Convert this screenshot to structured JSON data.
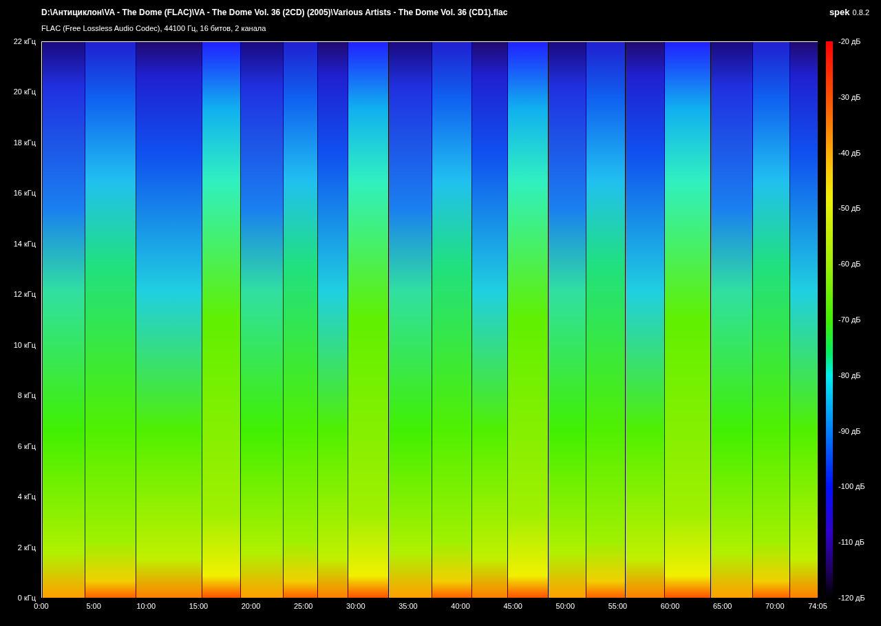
{
  "header": {
    "file_path": "D:\\Антициклон\\VA - The Dome (FLAC)\\VA - The Dome Vol. 36 (2CD) (2005)\\Various Artists - The Dome Vol. 36 (CD1).flac",
    "app_name": "spek",
    "app_version": "0.8.2",
    "stream_info": "FLAC (Free Lossless Audio Codec), 44100 Гц, 16 битов, 2 канала"
  },
  "frequency_axis": [
    "22 кГц",
    "20 кГц",
    "18 кГц",
    "16 кГц",
    "14 кГц",
    "12 кГц",
    "10 кГц",
    "8 кГц",
    "6 кГц",
    "4 кГц",
    "2 кГц",
    "0 кГц"
  ],
  "time_axis": [
    "0:00",
    "5:00",
    "10:00",
    "15:00",
    "20:00",
    "25:00",
    "30:00",
    "35:00",
    "40:00",
    "45:00",
    "50:00",
    "55:00",
    "60:00",
    "65:00",
    "70:00",
    "74:05"
  ],
  "level_scale": [
    "-20 дБ",
    "-30 дБ",
    "-40 дБ",
    "-50 дБ",
    "-60 дБ",
    "-70 дБ",
    "-80 дБ",
    "-90 дБ",
    "-100 дБ",
    "-110 дБ",
    "-120 дБ"
  ]
}
